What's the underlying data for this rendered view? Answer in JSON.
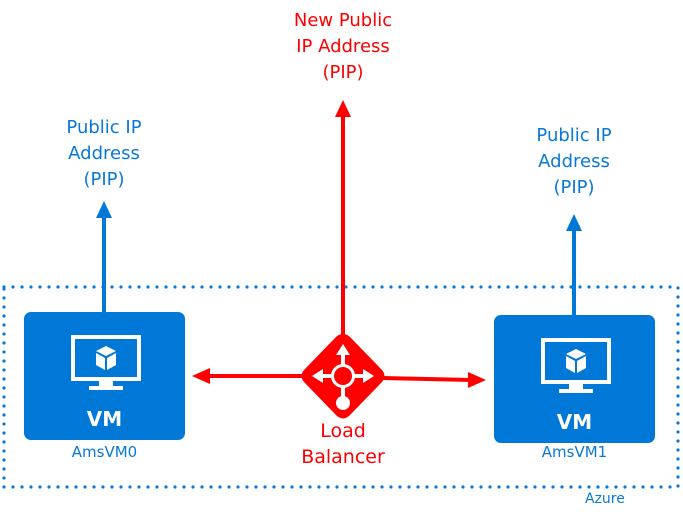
{
  "diagram": {
    "container": {
      "label": "Azure",
      "border_color": "#0a78d7"
    },
    "colors": {
      "blue": "#0078d7",
      "red": "#ff0000",
      "white": "#ffffff"
    },
    "public_ip_left": {
      "line1": "Public IP",
      "line2": "Address",
      "line3": "(PIP)"
    },
    "public_ip_right": {
      "line1": "Public IP",
      "line2": "Address",
      "line3": "(PIP)"
    },
    "new_public_ip": {
      "line1": "New Public",
      "line2": "IP Address",
      "line3": "(PIP)"
    },
    "vms": [
      {
        "type_label": "VM",
        "name": "AmsVM0",
        "icon": "virtual-machine-icon"
      },
      {
        "type_label": "VM",
        "name": "AmsVM1",
        "icon": "virtual-machine-icon"
      }
    ],
    "load_balancer": {
      "line1": "Load",
      "line2": "Balancer",
      "icon": "load-balancer-icon"
    },
    "connections": [
      {
        "from": "AmsVM0",
        "to": "Public IP Address (PIP)",
        "color": "#0078d7"
      },
      {
        "from": "AmsVM1",
        "to": "Public IP Address (PIP)",
        "color": "#0078d7"
      },
      {
        "from": "Load Balancer",
        "to": "New Public IP Address (PIP)",
        "color": "#ff0000"
      },
      {
        "from": "Load Balancer",
        "to": "AmsVM0",
        "color": "#ff0000"
      },
      {
        "from": "Load Balancer",
        "to": "AmsVM1",
        "color": "#ff0000"
      }
    ]
  }
}
